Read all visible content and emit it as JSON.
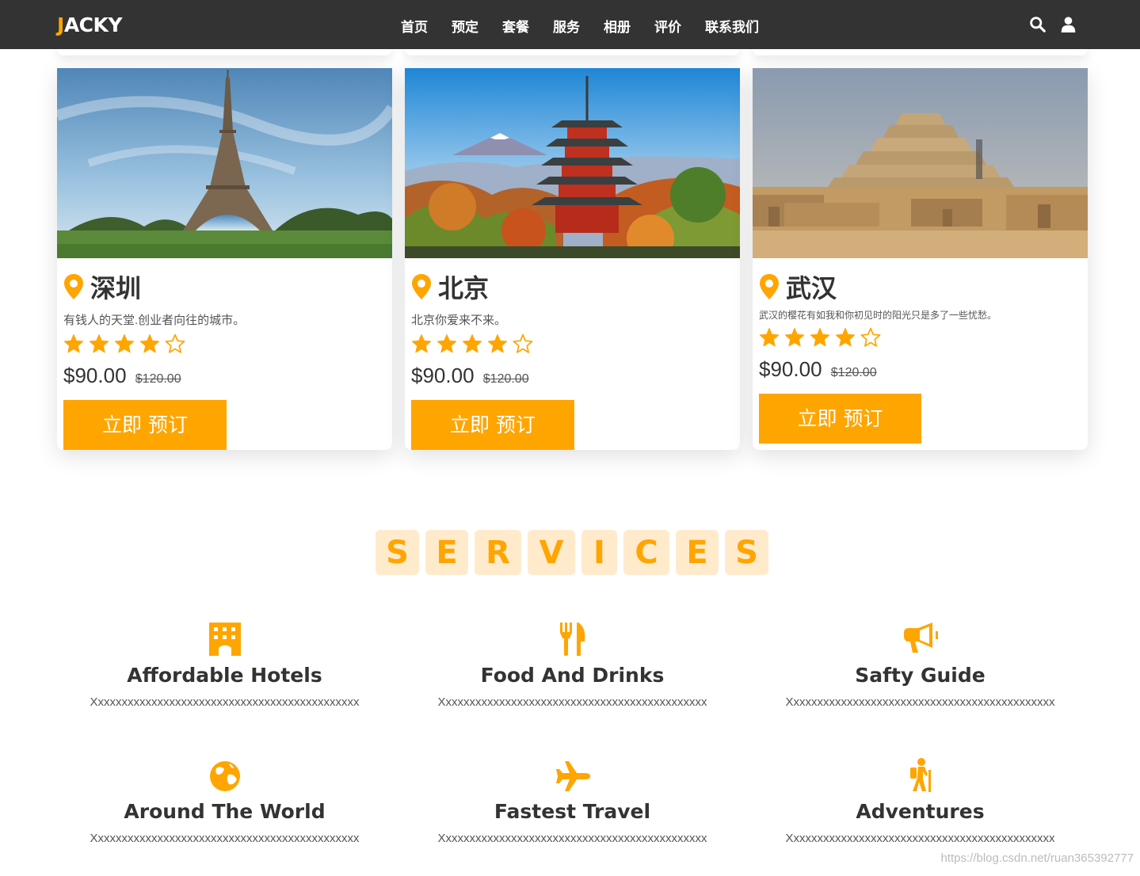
{
  "header": {
    "logo_first": "J",
    "logo_rest": "ACKY",
    "nav": [
      "首页",
      "预定",
      "套餐",
      "服务",
      "相册",
      "评价",
      "联系我们"
    ],
    "icons": [
      "search-icon",
      "user-icon"
    ]
  },
  "cards": [
    {
      "title": "深圳",
      "description": "有钱人的天堂.创业者向往的城市。",
      "rating": 4,
      "rating_max": 5,
      "price": "$90.00",
      "old_price": "$120.00",
      "button": "立即 预订"
    },
    {
      "title": "北京",
      "description": "北京你爱来不来。",
      "rating": 4,
      "rating_max": 5,
      "price": "$90.00",
      "old_price": "$120.00",
      "button": "立即 预订"
    },
    {
      "title": "武汉",
      "description": "武汉的樱花有如我和你初见时的阳光只是多了一些忧愁。",
      "rating": 4,
      "rating_max": 5,
      "price": "$90.00",
      "old_price": "$120.00",
      "button": "立即 预订"
    }
  ],
  "services_heading": [
    "S",
    "E",
    "R",
    "V",
    "I",
    "C",
    "E",
    "S"
  ],
  "services": [
    {
      "icon": "hotel-icon",
      "title": "Affordable Hotels",
      "text": "Xxxxxxxxxxxxxxxxxxxxxxxxxxxxxxxxxxxxxxxxxxxxx"
    },
    {
      "icon": "utensils-icon",
      "title": "Food And Drinks",
      "text": "Xxxxxxxxxxxxxxxxxxxxxxxxxxxxxxxxxxxxxxxxxxxxx"
    },
    {
      "icon": "bullhorn-icon",
      "title": "Safty Guide",
      "text": "Xxxxxxxxxxxxxxxxxxxxxxxxxxxxxxxxxxxxxxxxxxxxx"
    },
    {
      "icon": "globe-icon",
      "title": "Around The World",
      "text": "Xxxxxxxxxxxxxxxxxxxxxxxxxxxxxxxxxxxxxxxxxxxxx"
    },
    {
      "icon": "plane-icon",
      "title": "Fastest Travel",
      "text": "Xxxxxxxxxxxxxxxxxxxxxxxxxxxxxxxxxxxxxxxxxxxxx"
    },
    {
      "icon": "hiking-icon",
      "title": "Adventures",
      "text": "Xxxxxxxxxxxxxxxxxxxxxxxxxxxxxxxxxxxxxxxxxxxxx"
    }
  ],
  "watermark": "https://blog.csdn.net/ruan365392777",
  "colors": {
    "accent": "#ffa500",
    "header_bg": "#333333",
    "heading_tile": "#ffebcc",
    "text": "#333333"
  }
}
